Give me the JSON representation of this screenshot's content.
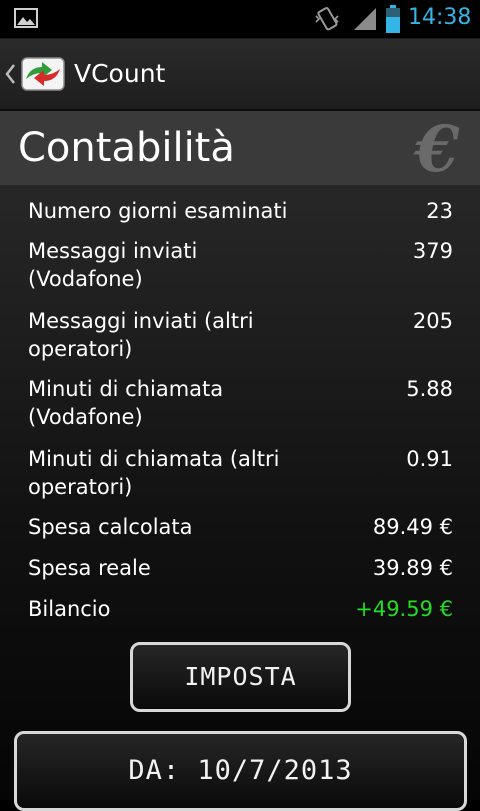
{
  "status_bar": {
    "time": "14:38",
    "icons": [
      "gallery-icon",
      "vibrate-icon",
      "signal-icon",
      "battery-icon"
    ],
    "accent_color": "#33b5e5"
  },
  "action_bar": {
    "title": "VCount",
    "back_icon": "chevron-left-icon",
    "logo_icon": "vcount-logo-icon"
  },
  "header": {
    "title": "Contabilità",
    "icon": "euro-icon"
  },
  "rows": [
    {
      "label": "Numero giorni esaminati",
      "value": "23"
    },
    {
      "label": "Messaggi inviati\n(Vodafone)",
      "value": "379"
    },
    {
      "label": "Messaggi inviati (altri\noperatori)",
      "value": "205"
    },
    {
      "label": "Minuti di chiamata\n(Vodafone)",
      "value": "5.88"
    },
    {
      "label": "Minuti di chiamata (altri\noperatori)",
      "value": "0.91"
    },
    {
      "label": "Spesa calcolata",
      "value": "89.49 €"
    },
    {
      "label": "Spesa reale",
      "value": "39.89 €"
    },
    {
      "label": "Bilancio",
      "value": "+49.59 €",
      "value_color": "#22dd22"
    }
  ],
  "buttons": {
    "imposta": "IMPOSTA",
    "date": "DA: 10/7/2013"
  }
}
